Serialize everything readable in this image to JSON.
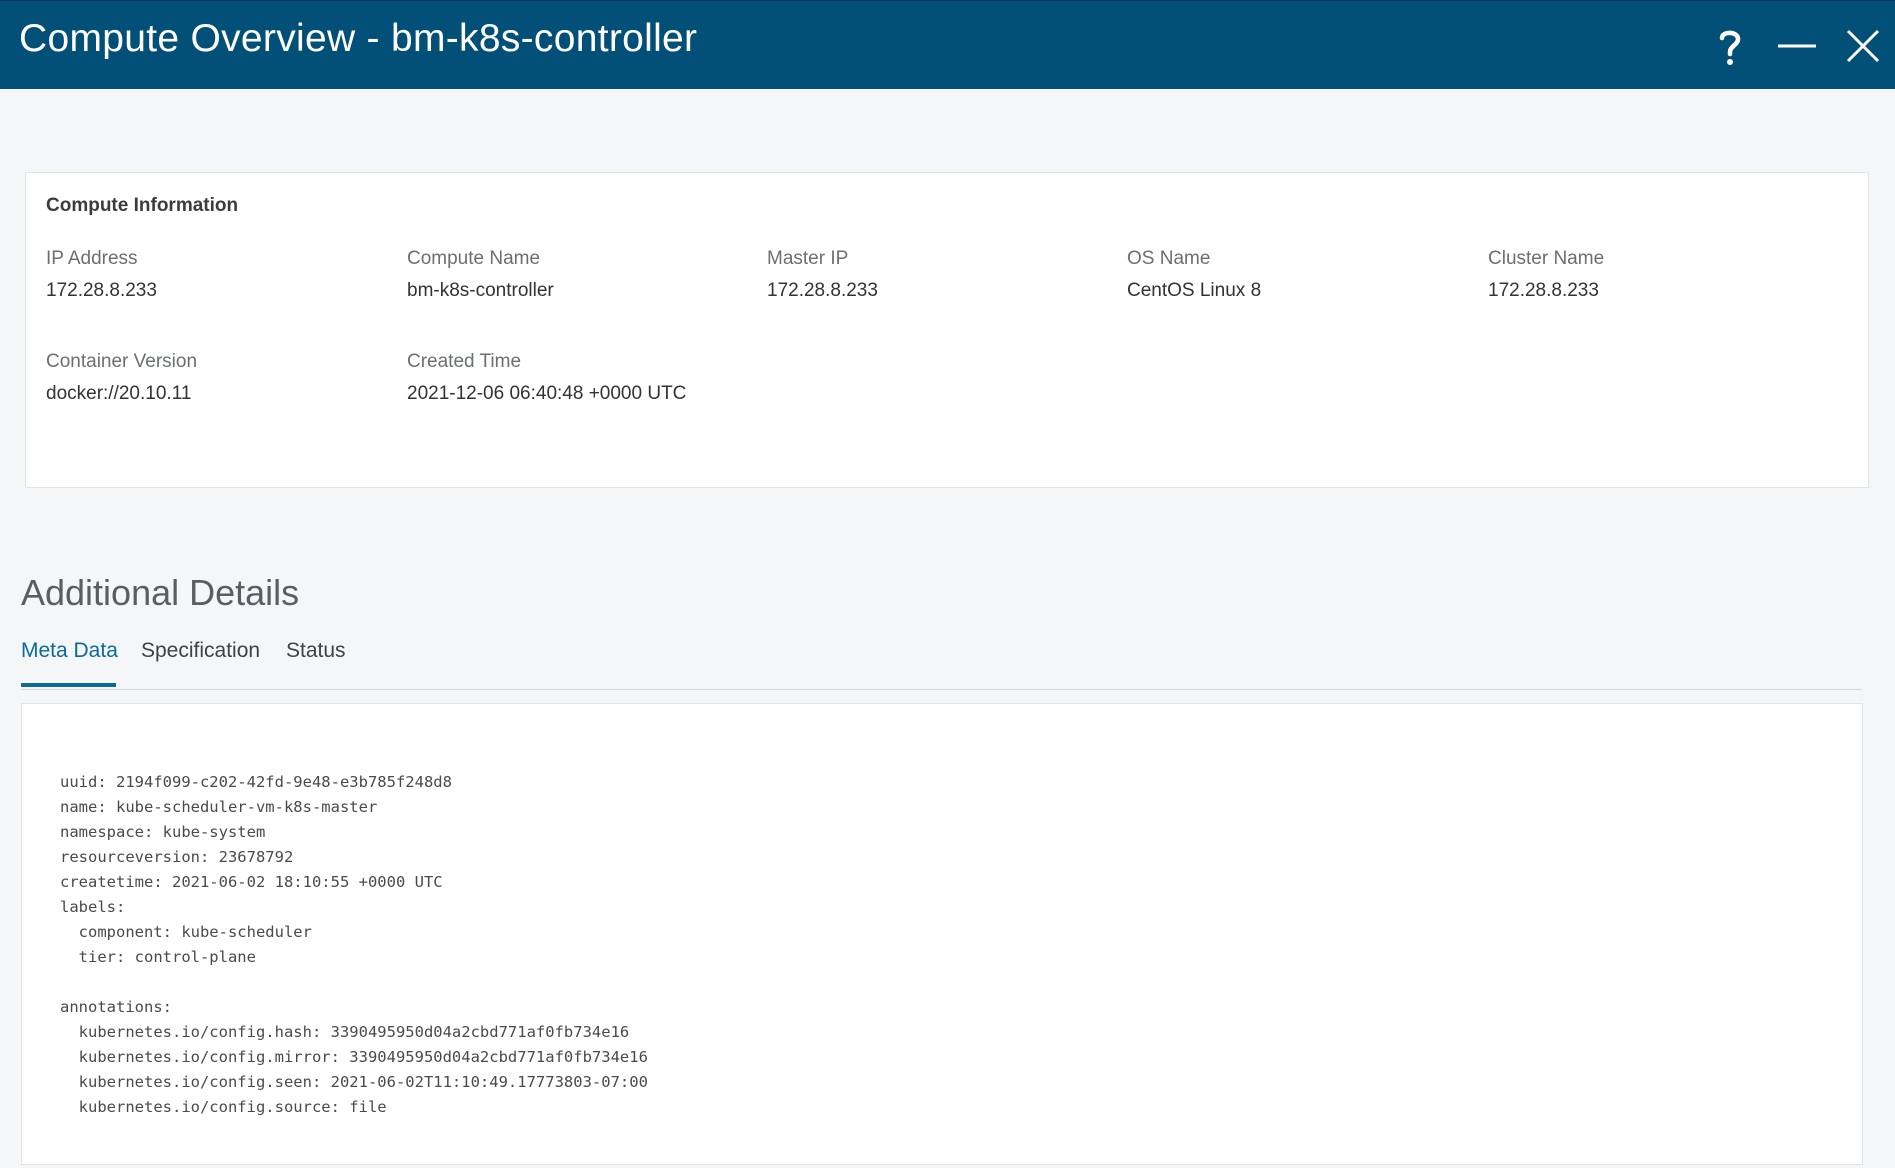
{
  "window": {
    "title": "Compute Overview - bm-k8s-controller",
    "controls": [
      "help-icon",
      "minimize-icon",
      "close-icon"
    ]
  },
  "compute_info": {
    "title": "Compute Information",
    "fields": [
      {
        "label": "IP Address",
        "value": "172.28.8.233"
      },
      {
        "label": "Compute Name",
        "value": "bm-k8s-controller"
      },
      {
        "label": "Master IP",
        "value": "172.28.8.233"
      },
      {
        "label": "OS Name",
        "value": "CentOS Linux 8"
      },
      {
        "label": "Cluster Name",
        "value": "172.28.8.233"
      },
      {
        "label": "Container Version",
        "value": "docker://20.10.11"
      },
      {
        "label": "Created Time",
        "value": "2021-12-06 06:40:48 +0000 UTC"
      }
    ]
  },
  "additional": {
    "title": "Additional Details",
    "tabs": [
      {
        "label": "Meta Data",
        "active": true
      },
      {
        "label": "Specification",
        "active": false
      },
      {
        "label": "Status",
        "active": false
      }
    ],
    "metadata_text": "uuid: 2194f099-c202-42fd-9e48-e3b785f248d8\nname: kube-scheduler-vm-k8s-master\nnamespace: kube-system\nresourceversion: 23678792\ncreatetime: 2021-06-02 18:10:55 +0000 UTC\nlabels:\n  component: kube-scheduler\n  tier: control-plane\n\nannotations:\n  kubernetes.io/config.hash: 3390495950d04a2cbd771af0fb734e16\n  kubernetes.io/config.mirror: 3390495950d04a2cbd771af0fb734e16\n  kubernetes.io/config.seen: 2021-06-02T11:10:49.17773803-07:00\n  kubernetes.io/config.source: file"
  },
  "colors": {
    "titlebar": "#025077",
    "accent": "#0b6a9a",
    "background": "#f5f6f8"
  }
}
